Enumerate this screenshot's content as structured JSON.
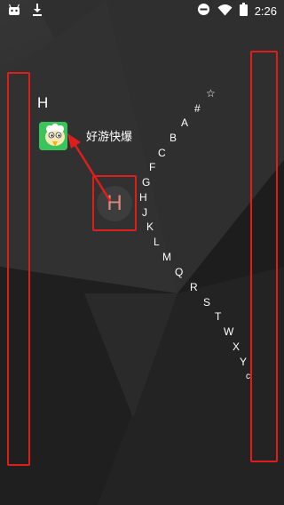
{
  "status_bar": {
    "time": "2:26",
    "left_icons": [
      "android-icon",
      "download-icon"
    ],
    "right_icons": [
      "dnd-icon",
      "wifi-icon",
      "battery-icon"
    ]
  },
  "section_letter": "H",
  "app": {
    "label": "好游快爆",
    "icon": "app-icon-bird"
  },
  "center_letter": "H",
  "index_letters": [
    "☆",
    "#",
    "A",
    "B",
    "C",
    "F",
    "G",
    "H",
    "J",
    "K",
    "L",
    "M",
    "Q",
    "R",
    "S",
    "T",
    "W",
    "X",
    "Y",
    "c"
  ],
  "colors": {
    "highlight": "#e01d1d",
    "center_letter": "#d98a7d",
    "text": "#ffffff"
  }
}
